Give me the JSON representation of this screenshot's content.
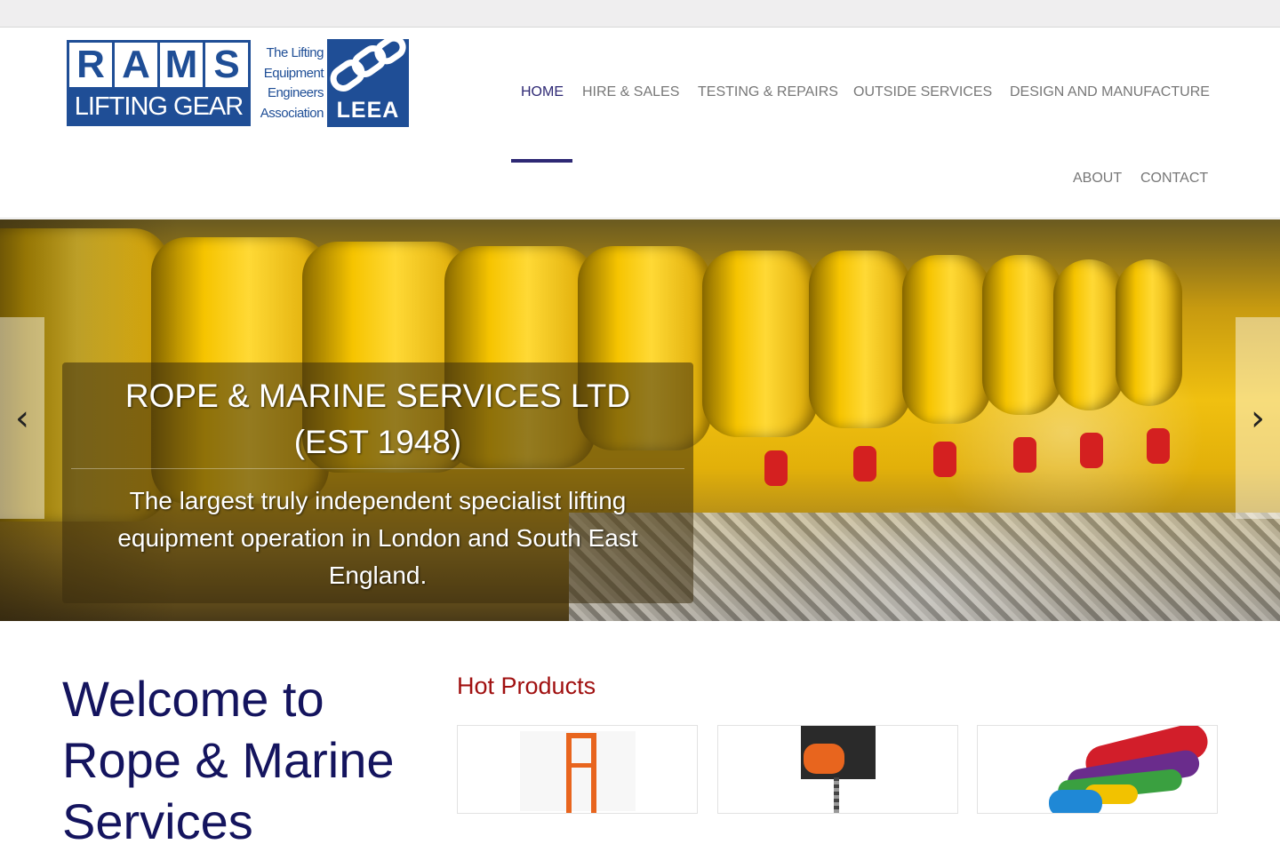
{
  "logo": {
    "rams_letters": [
      "R",
      "A",
      "M",
      "S"
    ],
    "rams_subtitle": "LIFTING GEAR",
    "association_lines": [
      "The Lifting",
      "Equipment",
      "Engineers",
      "Association"
    ],
    "leea": "LEEA"
  },
  "nav": {
    "items": [
      {
        "label": "HOME",
        "active": true
      },
      {
        "label": "HIRE & SALES",
        "active": false
      },
      {
        "label": "TESTING & REPAIRS",
        "active": false
      },
      {
        "label": "OUTSIDE SERVICES",
        "active": false
      },
      {
        "label": "DESIGN AND MANUFACTURE",
        "active": false
      },
      {
        "label": "ABOUT",
        "active": false
      },
      {
        "label": "CONTACT",
        "active": false
      }
    ]
  },
  "hero": {
    "title_line1": "ROPE & MARINE SERVICES LTD",
    "title_line2": "(EST 1948)",
    "text": "The largest truly independent specialist lifting equipment operation in London and South East England.",
    "prev_icon": "chevron-left-icon",
    "next_icon": "chevron-right-icon"
  },
  "welcome": {
    "line1": "Welcome to",
    "line2": "Rope & Marine",
    "line3": "Services"
  },
  "hot_products": {
    "title": "Hot Products"
  },
  "colors": {
    "brand_blue": "#1f4e96",
    "nav_active": "#2d2874",
    "hot_products_red": "#a01010",
    "welcome_navy": "#14145e"
  }
}
